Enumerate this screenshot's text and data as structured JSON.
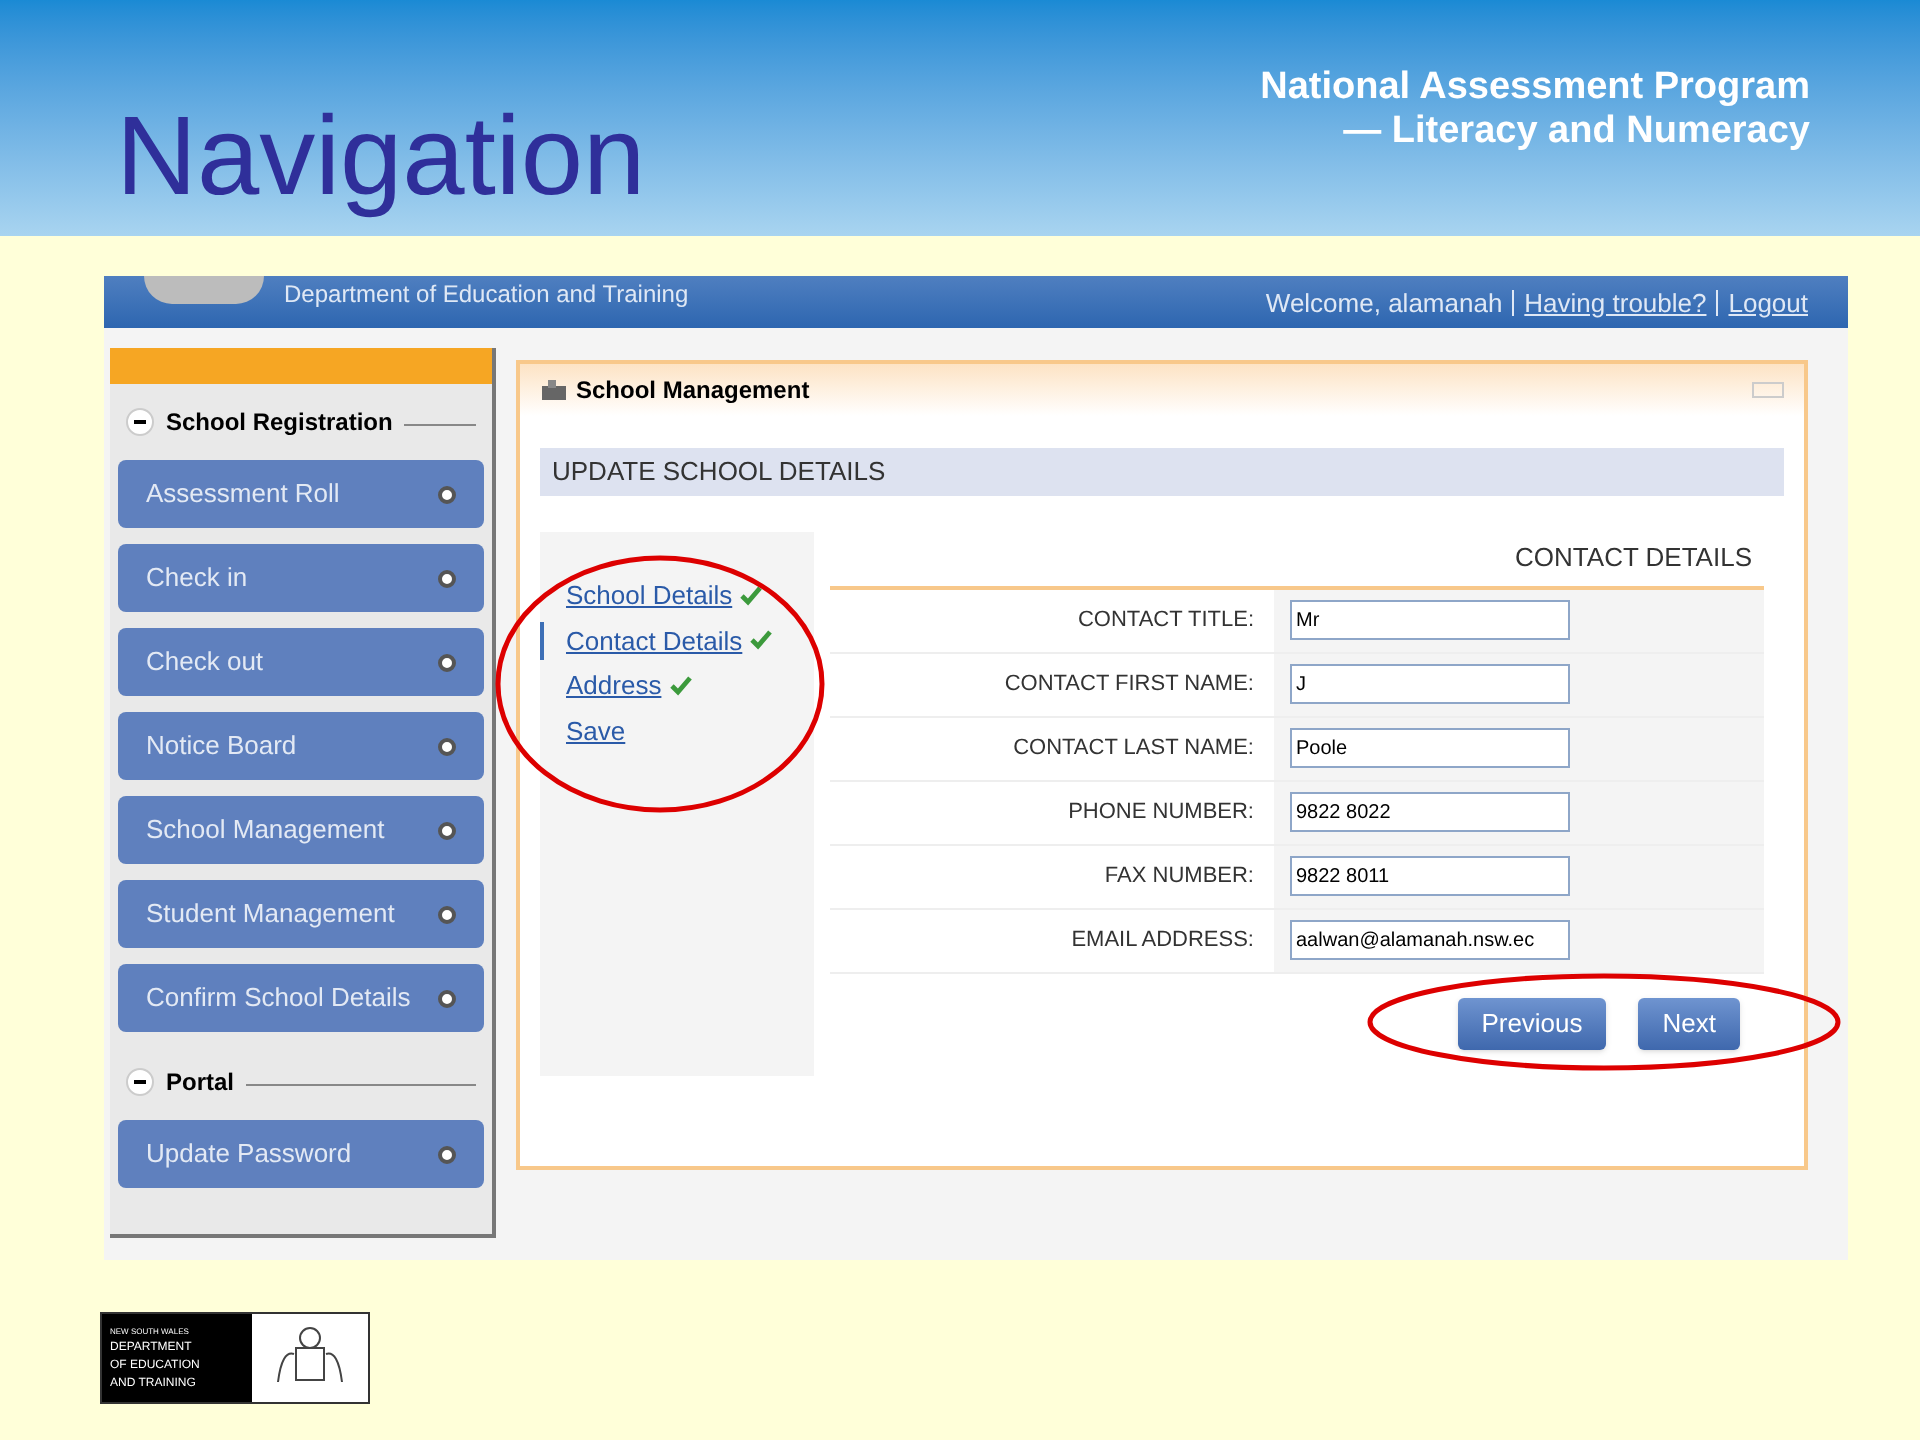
{
  "slide": {
    "title": "Navigation",
    "program_lines": [
      "National Assessment Program",
      "— Literacy and Numeracy"
    ],
    "footer_logo_lines": [
      "NEW SOUTH WALES",
      "DEPARTMENT",
      "OF EDUCATION",
      "AND TRAINING"
    ]
  },
  "app": {
    "header": {
      "department": "Department of Education and Training",
      "welcome": "Welcome, alamanah",
      "links": [
        "Having trouble?",
        "Logout"
      ]
    },
    "sidebar": [
      {
        "title": "School Registration",
        "expanded": true,
        "items": [
          {
            "label": "Assessment Roll"
          },
          {
            "label": "Check in"
          },
          {
            "label": "Check out"
          },
          {
            "label": "Notice Board"
          },
          {
            "label": "School Management"
          },
          {
            "label": "Student Management"
          },
          {
            "label": "Confirm School Details"
          }
        ]
      },
      {
        "title": "Portal",
        "expanded": true,
        "items": [
          {
            "label": "Update Password"
          }
        ]
      }
    ],
    "panel": {
      "title": "School Management",
      "section": "UPDATE SCHOOL DETAILS",
      "steps": [
        {
          "label": "School Details",
          "done": true,
          "selected": false
        },
        {
          "label": "Contact Details",
          "done": true,
          "selected": true
        },
        {
          "label": "Address",
          "done": true,
          "selected": false
        },
        {
          "label": "Save",
          "done": false,
          "selected": false
        }
      ],
      "form": {
        "heading": "CONTACT DETAILS",
        "fields": [
          {
            "label": "CONTACT TITLE:",
            "value": "Mr"
          },
          {
            "label": "CONTACT FIRST NAME:",
            "value": "J"
          },
          {
            "label": "CONTACT LAST NAME:",
            "value": "Poole"
          },
          {
            "label": "PHONE NUMBER:",
            "value": "9822 8022"
          },
          {
            "label": "FAX NUMBER:",
            "value": "9822 8011"
          },
          {
            "label": "EMAIL ADDRESS:",
            "value": "aalwan@alamanah.nsw.ec"
          }
        ]
      },
      "buttons": [
        "Previous",
        "Next"
      ]
    }
  }
}
